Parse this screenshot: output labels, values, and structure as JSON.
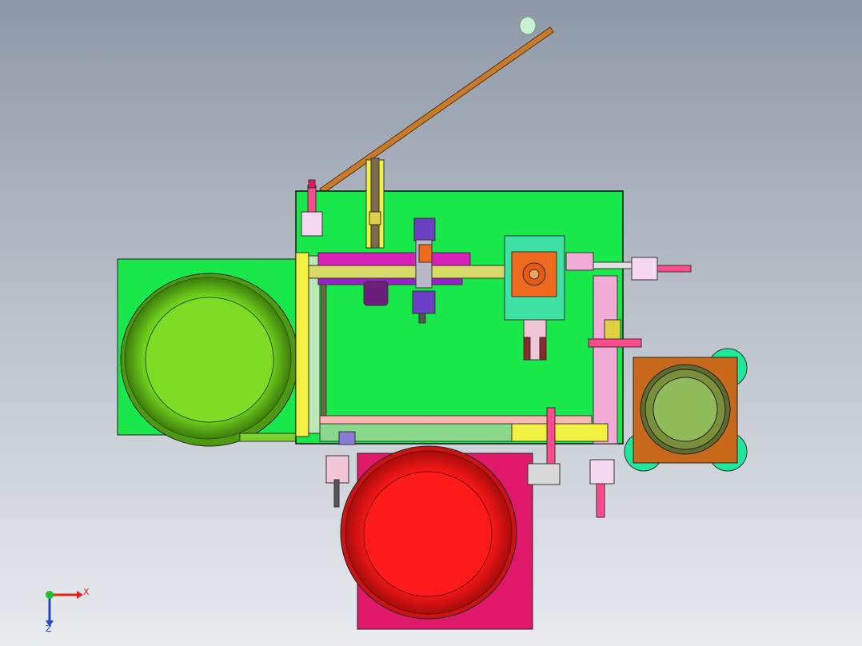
{
  "viewport": {
    "background_top": "#8e99a8",
    "background_bottom": "#e9ebee"
  },
  "triad": {
    "x_label": "X",
    "y_label": "Y",
    "z_label": "Z",
    "x_color": "#e0241b",
    "y_color": "#1fbf2b",
    "z_color": "#2346c8"
  },
  "model": {
    "components": [
      {
        "name": "main-base-plate",
        "color": "#19e84b"
      },
      {
        "name": "left-vibratory-bowl",
        "color": "#4d9a12"
      },
      {
        "name": "bottom-vibratory-bowl",
        "color": "#e81717"
      },
      {
        "name": "right-vibratory-bowl",
        "color": "#c8681a"
      },
      {
        "name": "feed-chute",
        "color": "#c77a2a"
      },
      {
        "name": "rotary-indexer",
        "color": "#f06a1e"
      }
    ]
  }
}
